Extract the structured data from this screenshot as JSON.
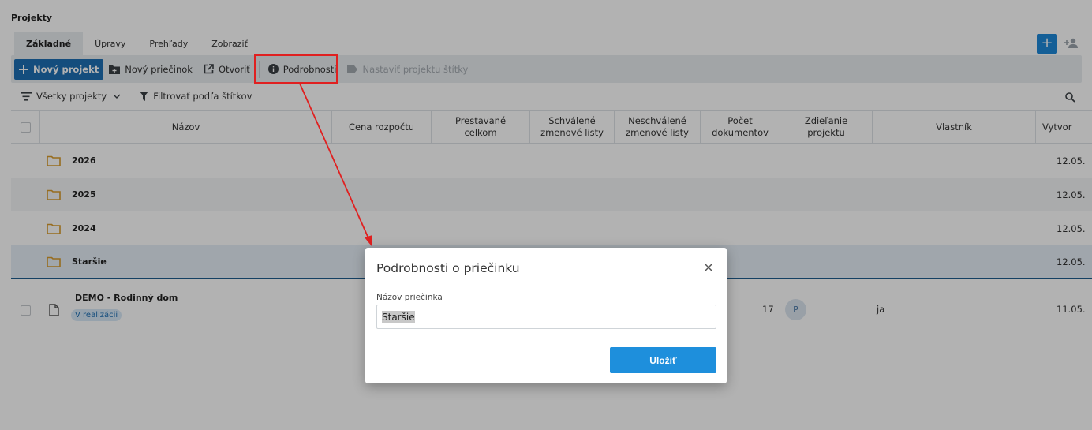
{
  "page": {
    "title": "Projekty"
  },
  "tabs": [
    {
      "label": "Základné",
      "active": true
    },
    {
      "label": "Úpravy",
      "active": false
    },
    {
      "label": "Prehľady",
      "active": false
    },
    {
      "label": "Zobraziť",
      "active": false
    }
  ],
  "toolbar": {
    "new_project": "Nový projekt",
    "new_folder": "Nový priečinok",
    "open": "Otvoriť",
    "details": "Podrobnosti",
    "set_tags": "Nastaviť projektu štítky"
  },
  "filters": {
    "all_projects": "Všetky projekty",
    "filter_by_tags": "Filtrovať podľa štítkov"
  },
  "grid": {
    "columns": {
      "name": "Názov",
      "budget": "Cena rozpočtu",
      "built_l1": "Prestavané",
      "built_l2": "celkom",
      "approved_l1": "Schválené",
      "approved_l2": "zmenové listy",
      "unapproved_l1": "Neschválené",
      "unapproved_l2": "zmenové listy",
      "docs_l1": "Počet",
      "docs_l2": "dokumentov",
      "share_l1": "Zdieľanie",
      "share_l2": "projektu",
      "owner": "Vlastník",
      "created": "Vytvor"
    },
    "rows": [
      {
        "type": "folder",
        "name": "2026",
        "date": "12.05."
      },
      {
        "type": "folder",
        "name": "2025",
        "date": "12.05."
      },
      {
        "type": "folder",
        "name": "2024",
        "date": "12.05."
      },
      {
        "type": "folder",
        "name": "Staršie",
        "date": "12.05."
      },
      {
        "type": "project",
        "name": "DEMO - Rodinný dom",
        "status": "V realizácii",
        "docs": "17",
        "share_avatar": "P",
        "owner": "ja",
        "date": "11.05."
      }
    ]
  },
  "dialog": {
    "title": "Podrobnosti o priečinku",
    "field_label": "Názov priečinka",
    "field_value": "Staršie",
    "save_label": "Uložiť"
  },
  "colors": {
    "accent": "#1e88d9",
    "primary_button": "#1e6fb4",
    "folder": "#d89b2b",
    "annotation": "#e02020"
  }
}
